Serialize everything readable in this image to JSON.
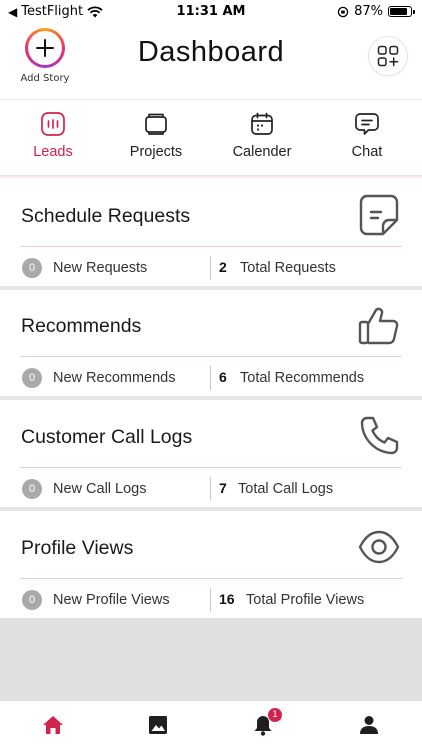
{
  "status_bar": {
    "carrier": "TestFlight",
    "time": "11:31 AM",
    "battery": "87%",
    "battery_level": 0.87
  },
  "header": {
    "add_story_label": "Add Story",
    "title": "Dashboard"
  },
  "tabs": [
    {
      "label": "Leads",
      "icon": "leads-icon",
      "active": true
    },
    {
      "label": "Projects",
      "icon": "projects-icon",
      "active": false
    },
    {
      "label": "Calender",
      "icon": "calendar-icon",
      "active": false
    },
    {
      "label": "Chat",
      "icon": "chat-icon",
      "active": false
    }
  ],
  "cards": [
    {
      "title": "Schedule Requests",
      "icon": "document-icon",
      "new_count": "0",
      "new_label": "New Requests",
      "total_count": "2",
      "total_label": "Total Requests"
    },
    {
      "title": "Recommends",
      "icon": "thumbs-up-icon",
      "new_count": "0",
      "new_label": "New Recommends",
      "total_count": "6",
      "total_label": "Total Recommends"
    },
    {
      "title": "Customer Call Logs",
      "icon": "phone-icon",
      "new_count": "0",
      "new_label": "New Call Logs",
      "total_count": "7",
      "total_label": "Total Call Logs"
    },
    {
      "title": "Profile Views",
      "icon": "eye-icon",
      "new_count": "0",
      "new_label": "New Profile Views",
      "total_count": "16",
      "total_label": "Total Profile Views"
    }
  ],
  "bottom_nav": {
    "items": [
      {
        "icon": "home-icon",
        "active": true
      },
      {
        "icon": "gallery-icon",
        "active": false
      },
      {
        "icon": "bell-icon",
        "active": false,
        "badge": "1"
      },
      {
        "icon": "profile-icon",
        "active": false
      }
    ]
  },
  "colors": {
    "accent": "#d0234e",
    "muted_badge": "#a9a9a9",
    "divider": "#e3cfd6"
  }
}
